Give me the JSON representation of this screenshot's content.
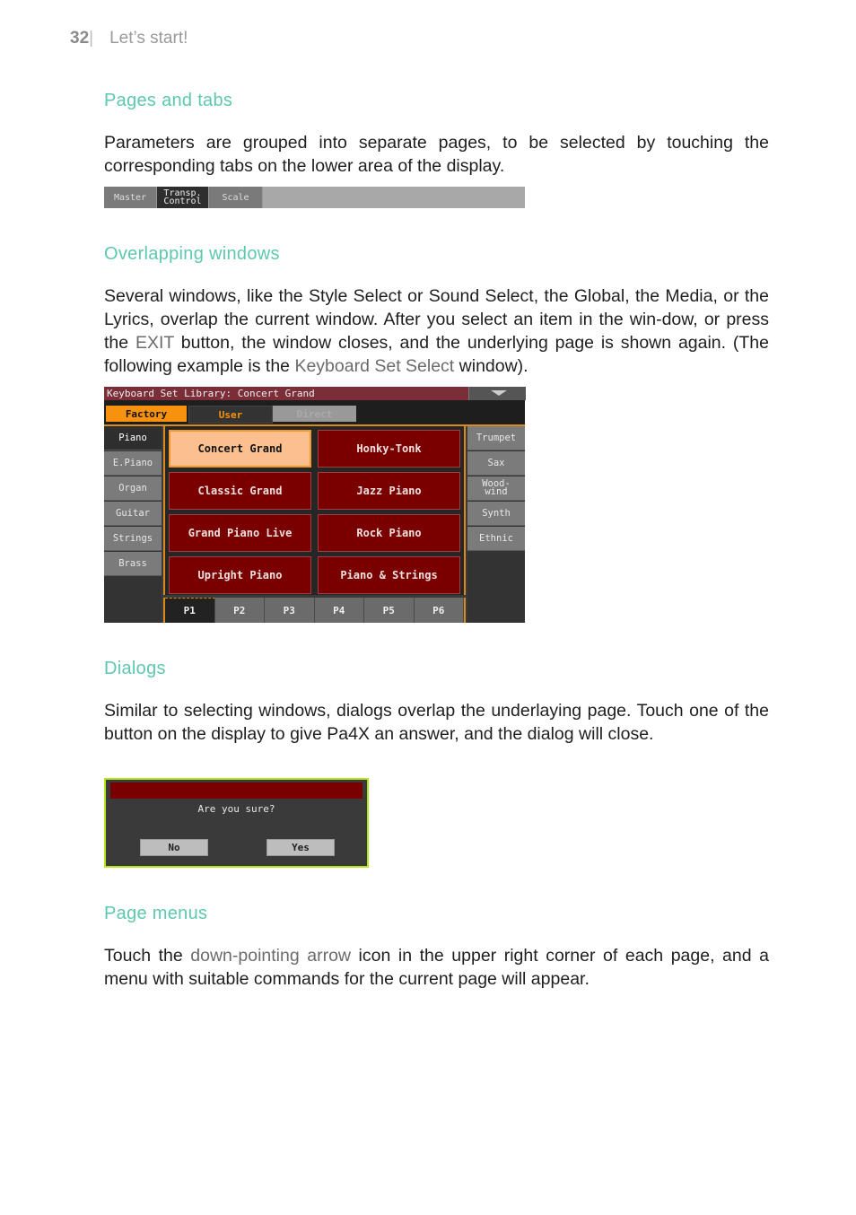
{
  "header": {
    "page_number": "32",
    "separator": "|",
    "chapter": "Let’s start!"
  },
  "sections": {
    "pages_tabs": {
      "heading": "Pages and tabs",
      "body": "Parameters are grouped into separate pages, to be selected by touching the corresponding tabs on the lower area of the display."
    },
    "overlapping": {
      "heading": "Overlapping windows",
      "body_1": "Several windows, like the Style Select or Sound Select, the Global, the Media, or the Lyrics, overlap the current window. After you select an item in the win-dow, or press the ",
      "hl_1": "EXIT",
      "body_2": " button, the window closes, and the underlying page is shown again. (The following example is the ",
      "hl_2": "Keyboard Set Select",
      "body_3": " window)."
    },
    "dialogs": {
      "heading": "Dialogs",
      "body": "Similar to selecting windows, dialogs overlap the underlaying page. Touch one of the button on the display to give Pa4X an answer, and the dialog will close."
    },
    "page_menus": {
      "heading": "Page menus",
      "body_1": "Touch the ",
      "hl_1": "down-pointing arrow",
      "body_2": " icon in the upper right corner of each page, and a menu with suitable commands for the current page will appear."
    }
  },
  "tab_strip": {
    "tabs": [
      {
        "label": "Master",
        "selected": false
      },
      {
        "label": "Transp.\nControl",
        "selected": true
      },
      {
        "label": "Scale",
        "selected": false
      }
    ]
  },
  "keyboard_set_window": {
    "title": "Keyboard Set Library: Concert Grand",
    "library_tabs": [
      {
        "label": "Factory",
        "selected": true
      },
      {
        "label": "User",
        "selected": false
      },
      {
        "label": "Direct",
        "selected": false,
        "disabled": true
      }
    ],
    "left_categories": [
      {
        "label": "Piano",
        "selected": true
      },
      {
        "label": "E.Piano"
      },
      {
        "label": "Organ"
      },
      {
        "label": "Guitar"
      },
      {
        "label": "Strings"
      },
      {
        "label": "Brass"
      }
    ],
    "right_categories": [
      {
        "label": "Trumpet"
      },
      {
        "label": "Sax"
      },
      {
        "label": "Wood-\nwind"
      },
      {
        "label": "Synth"
      },
      {
        "label": "Ethnic"
      }
    ],
    "items": [
      {
        "label": "Concert Grand",
        "selected": true
      },
      {
        "label": "Honky-Tonk"
      },
      {
        "label": "Classic Grand"
      },
      {
        "label": "Jazz Piano"
      },
      {
        "label": "Grand Piano Live"
      },
      {
        "label": "Rock Piano"
      },
      {
        "label": "Upright Piano"
      },
      {
        "label": "Piano & Strings"
      }
    ],
    "pages": [
      {
        "label": "P1",
        "selected": true
      },
      {
        "label": "P2"
      },
      {
        "label": "P3"
      },
      {
        "label": "P4"
      },
      {
        "label": "P5"
      },
      {
        "label": "P6"
      }
    ],
    "menu_icon": "down-arrow-icon"
  },
  "dialog": {
    "message": "Are you sure?",
    "no_label": "No",
    "yes_label": "Yes"
  },
  "colors": {
    "heading": "#5dc8b0",
    "highlight": "#6b6b6b",
    "selected_orange": "#f19a2a",
    "item_red": "#7a0000",
    "dialog_border": "#b5e61d"
  }
}
